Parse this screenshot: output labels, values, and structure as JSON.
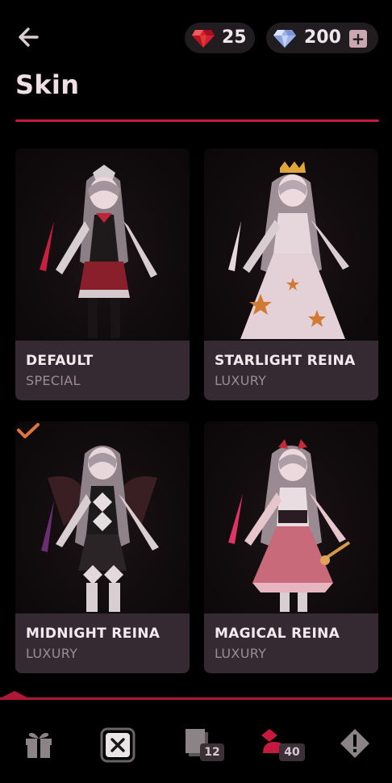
{
  "header": {
    "title": "Skin",
    "back_icon": "arrow-left-icon",
    "rubies": {
      "icon": "ruby-icon",
      "value": "25"
    },
    "gems": {
      "icon": "diamond-icon",
      "value": "200",
      "plus_icon": "plus-icon",
      "plus_label": "+"
    }
  },
  "colors": {
    "accent": "#c31a3e",
    "card_info_bg": "#352a31",
    "currency_pill": "#201c1f",
    "check": "#e0743d"
  },
  "skins": [
    {
      "name": "DEFAULT",
      "tier": "SPECIAL",
      "selected": false
    },
    {
      "name": "STARLIGHT REINA",
      "tier": "LUXURY",
      "selected": false
    },
    {
      "name": "MIDNIGHT REINA",
      "tier": "LUXURY",
      "selected": true
    },
    {
      "name": "MAGICAL REINA",
      "tier": "LUXURY",
      "selected": false
    }
  ],
  "nav": {
    "items": [
      {
        "icon": "gift-icon"
      },
      {
        "icon": "close-box-icon",
        "active": true
      },
      {
        "icon": "card-stack-icon",
        "badge": "12"
      },
      {
        "icon": "character-icon",
        "badge": "40"
      },
      {
        "icon": "alert-icon"
      }
    ]
  }
}
